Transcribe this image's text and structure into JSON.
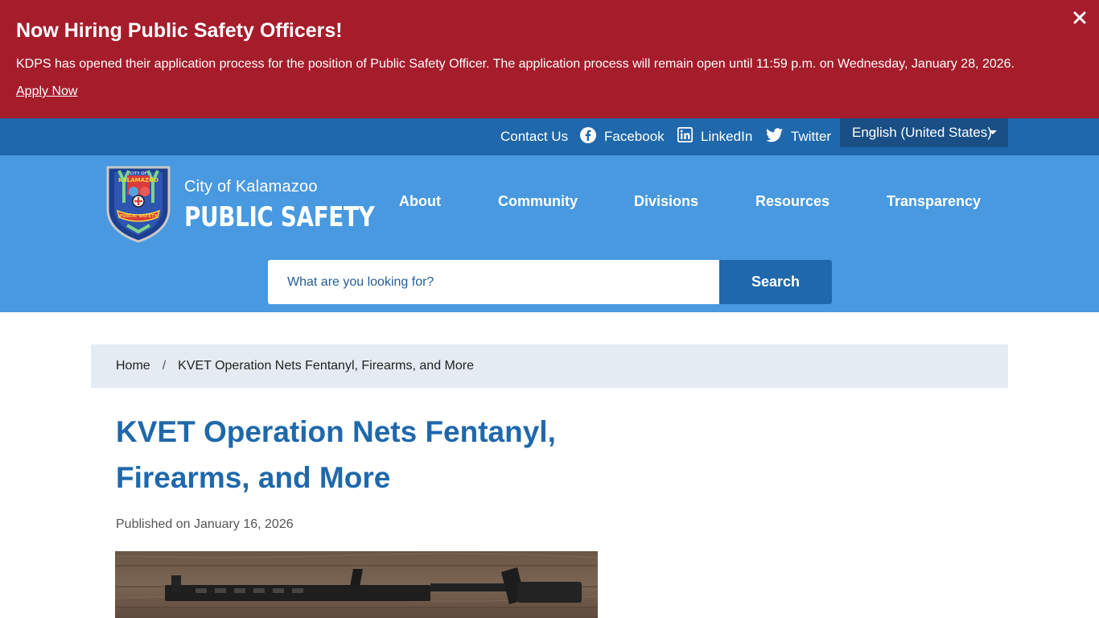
{
  "alert": {
    "title": "Now Hiring Public Safety Officers!",
    "text": "KDPS has opened their application process for the position of Public Safety Officer. The application process will remain open until 11:59 p.m. on Wednesday, January 28, 2026.",
    "link": "Apply Now",
    "close_icon": "close-icon"
  },
  "utility": {
    "contact": "Contact Us",
    "facebook": "Facebook",
    "linkedin": "LinkedIn",
    "twitter": "Twitter",
    "language": "English (United States)"
  },
  "logo": {
    "city": "City of Kalamazoo",
    "name": "PUBLIC SAFETY",
    "badge_top": "CITY OF",
    "badge_city": "KALAMAZOO",
    "badge_bottom": "PUBLIC SAFETY"
  },
  "nav": [
    "About",
    "Community",
    "Divisions",
    "Resources",
    "Transparency"
  ],
  "search": {
    "placeholder": "What are you looking for?",
    "button": "Search"
  },
  "breadcrumb": {
    "home": "Home",
    "separator": "/",
    "current": "KVET Operation Nets Fentanyl, Firearms, and More"
  },
  "article": {
    "title": "KVET Operation Nets Fentanyl, Firearms, and More",
    "published": "Published on January 16, 2026"
  },
  "colors": {
    "alert": "#a51c2b",
    "utility": "#1f68ab",
    "header": "#4899e0",
    "title": "#1f68ab"
  }
}
